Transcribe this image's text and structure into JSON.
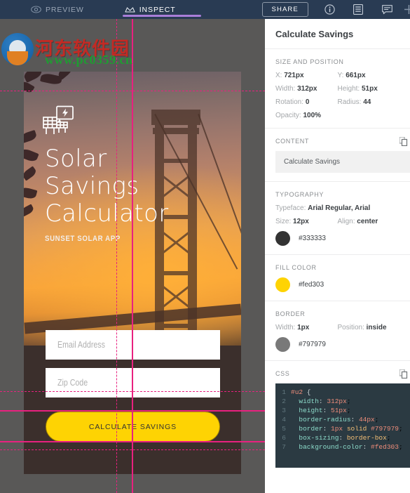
{
  "topbar": {
    "tabs": [
      {
        "label": "PREVIEW",
        "icon": "eye-icon",
        "active": false
      },
      {
        "label": "INSPECT",
        "icon": "crown-icon",
        "active": true
      }
    ],
    "share_label": "SHARE",
    "icons": [
      {
        "name": "info-icon"
      },
      {
        "name": "layers-panel-icon"
      },
      {
        "name": "comment-icon"
      },
      {
        "name": "plus-icon"
      }
    ],
    "bg_color": "#293b53",
    "active_underline_color": "#a97ed9"
  },
  "watermark": {
    "site_name": "河东软件园",
    "url": "www.pc0359.cn",
    "name_color": "#c32a24",
    "url_color": "#1f9c32"
  },
  "canvas": {
    "bg_color": "#595857",
    "guide_color": "#e8217f",
    "mockup": {
      "title": "Solar\nSavings\nCalculator",
      "subtitle": "SUNSET SOLAR APP",
      "logo_icon": "solar-panel-icon",
      "fields": [
        {
          "name": "email",
          "placeholder": "Email Address",
          "value": ""
        },
        {
          "name": "zip",
          "placeholder": "Zip Code",
          "value": ""
        }
      ],
      "cta_label": "CALCULATE SAVINGS",
      "cta_fill": "#fed303",
      "cta_text_color": "#333333"
    }
  },
  "panel": {
    "title": "Calculate Savings",
    "size_and_position": {
      "heading": "SIZE AND POSITION",
      "x_label": "X:",
      "x_value": "721px",
      "y_label": "Y:",
      "y_value": "661px",
      "width_label": "Width:",
      "width_value": "312px",
      "height_label": "Height:",
      "height_value": "51px",
      "rotation_label": "Rotation:",
      "rotation_value": "0",
      "radius_label": "Radius:",
      "radius_value": "44",
      "opacity_label": "Opacity:",
      "opacity_value": "100%"
    },
    "content": {
      "heading": "CONTENT",
      "value": "Calculate Savings",
      "copy_icon": "copy-icon"
    },
    "typography": {
      "heading": "TYPOGRAPHY",
      "typeface_label": "Typeface:",
      "typeface_value": "Arial Regular, Arial",
      "size_label": "Size:",
      "size_value": "12px",
      "align_label": "Align:",
      "align_value": "center",
      "color": "#333333"
    },
    "fill_color": {
      "heading": "FILL COLOR",
      "color": "#fed303"
    },
    "border": {
      "heading": "BORDER",
      "width_label": "Width:",
      "width_value": "1px",
      "position_label": "Position:",
      "position_value": "inside",
      "color": "#797979"
    },
    "css": {
      "heading": "CSS",
      "copy_icon": "copy-icon",
      "lines": [
        {
          "n": "1",
          "text": "#u2 {"
        },
        {
          "n": "2",
          "text": "  width: 312px;"
        },
        {
          "n": "3",
          "text": "  height: 51px;"
        },
        {
          "n": "4",
          "text": "  border-radius: 44px;"
        },
        {
          "n": "5",
          "text": "  border: 1px solid #797979;"
        },
        {
          "n": "6",
          "text": "  box-sizing: border-box;"
        },
        {
          "n": "7",
          "text": "  background-color: #fed303;"
        }
      ]
    }
  }
}
